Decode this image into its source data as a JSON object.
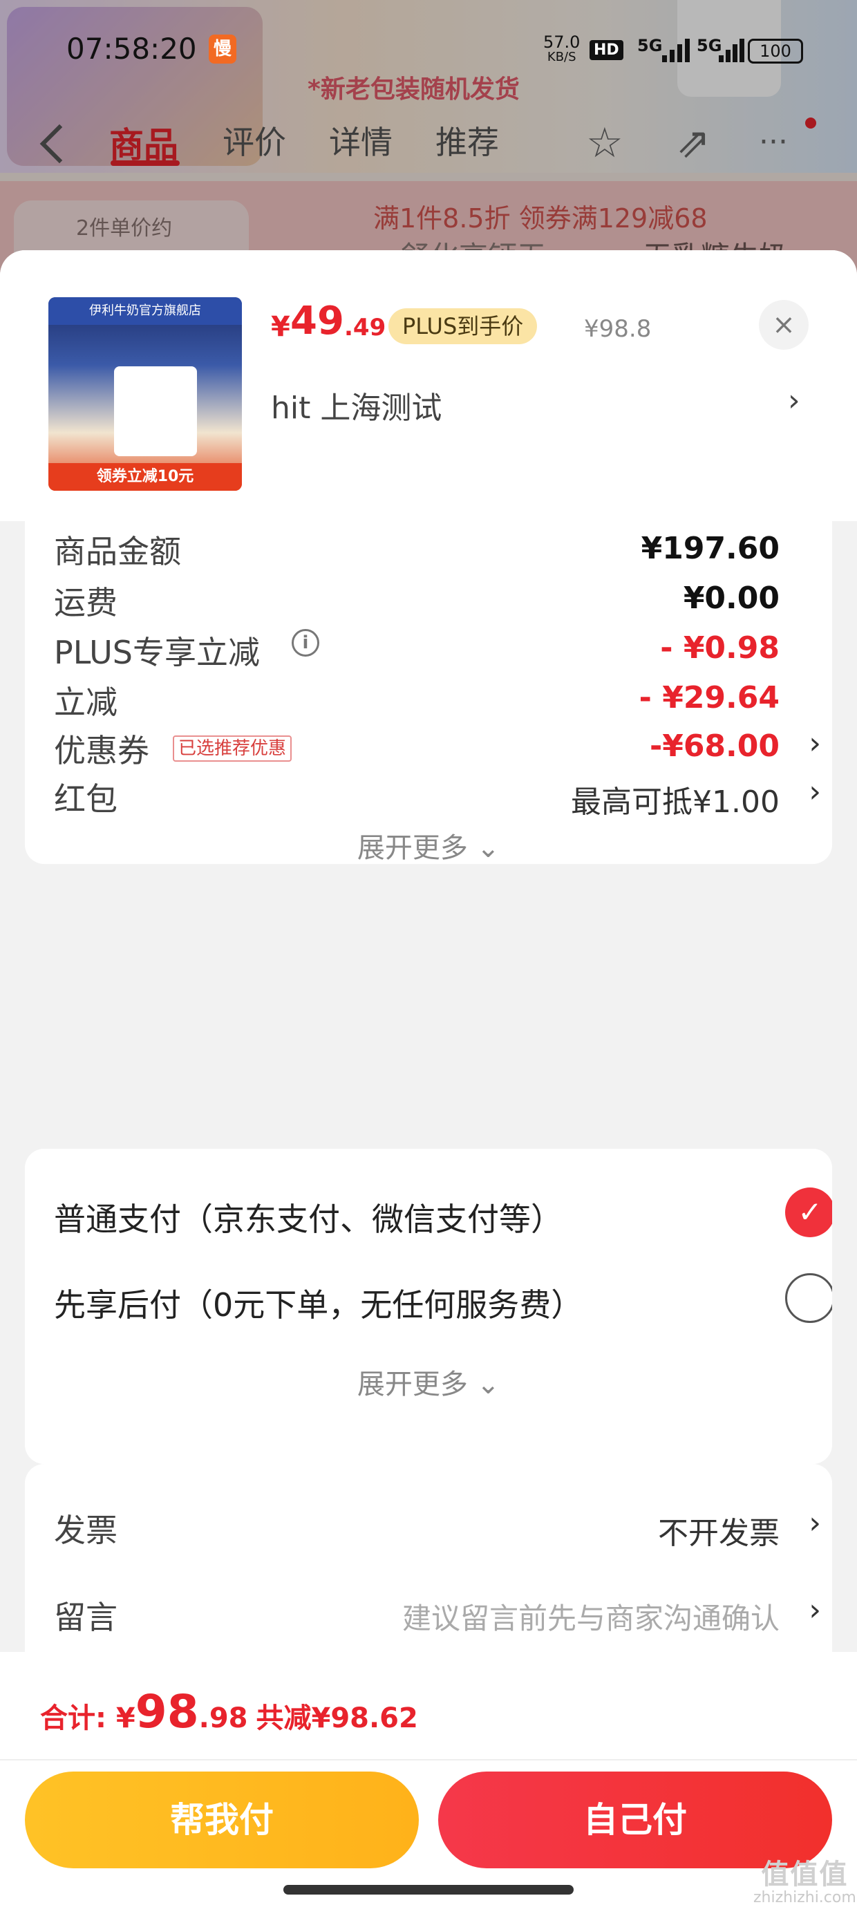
{
  "status_bar": {
    "time": "07:58:20",
    "slow_badge": "慢",
    "net_speed": "57.0",
    "net_unit": "KB/S",
    "hd": "HD",
    "sig1": "5G",
    "sig2": "5G",
    "battery": "100"
  },
  "background": {
    "banner_text": "*新老包装随机发货",
    "tabs": [
      "商品",
      "评价",
      "详情",
      "推荐"
    ],
    "promo_text": "满1件8.5折 领券满129减68",
    "pill_text": "2件单价约",
    "promo_mid": "舒化高钙无",
    "promo_right": "无乳糖牛奶"
  },
  "product": {
    "thumb_top": "伊利牛奶官方旗舰店",
    "thumb_bottom": "领券立减10元",
    "price_currency": "¥",
    "price_int": "49",
    "price_dec": ".49",
    "plus_badge": "PLUS到手价",
    "original_price": "¥98.8",
    "close": "×",
    "address": "hit  上海测试",
    "address_chevron": "›"
  },
  "fees": {
    "rows": [
      {
        "label": "商品金额",
        "value": "¥197.60"
      },
      {
        "label": "运费",
        "value": "¥0.00"
      },
      {
        "label": "PLUS专享立减",
        "value": "- ¥0.98"
      },
      {
        "label": "立减",
        "value": "- ¥29.64"
      },
      {
        "label": "优惠券",
        "tag": "已选推荐优惠",
        "value": "-¥68.00"
      },
      {
        "label": "红包",
        "value": "最高可抵¥1.00"
      }
    ],
    "expand": "展开更多 ⌄"
  },
  "payment": {
    "options": [
      {
        "label": "普通支付（京东支付、微信支付等）"
      },
      {
        "label": "先享后付（0元下单，无任何服务费）"
      }
    ],
    "check": "✓",
    "expand": "展开更多 ⌄"
  },
  "extras": {
    "invoice_label": "发票",
    "invoice_value": "不开发票",
    "message_label": "留言",
    "message_placeholder": "建议留言前先与商家沟通确认",
    "chevron": "›"
  },
  "footer": {
    "total_label": "合计: ",
    "total_currency": "¥",
    "total_int": "98",
    "total_dec": ".98",
    "total_saved": "共减¥98.62",
    "help_pay": "帮我付",
    "self_pay": "自己付"
  },
  "watermark": {
    "big": "值值值",
    "small": "zhizhizhi.com"
  },
  "colors": {
    "accent_red": "#e8232c",
    "help_button": "#ffb21a",
    "plus_badge_bg": "#fbe4a5"
  }
}
